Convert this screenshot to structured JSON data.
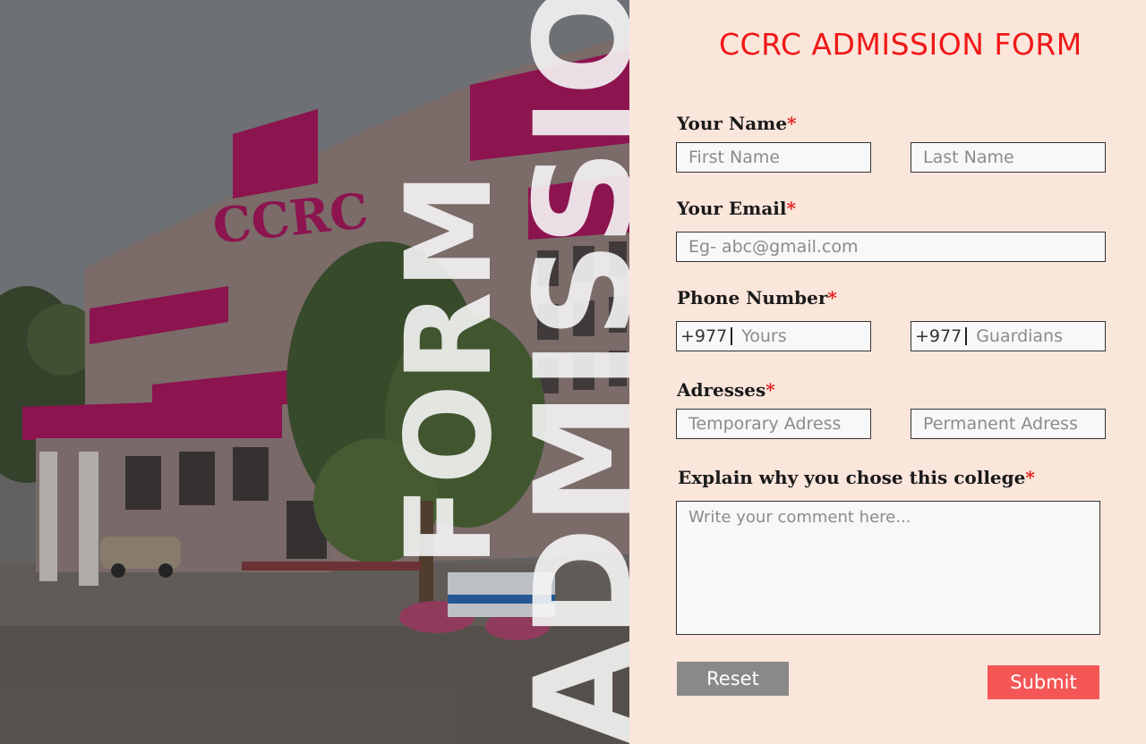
{
  "hero": {
    "building_sign": "CCRC",
    "overlay_word_1": "ADMISSION",
    "overlay_word_2": "FORM"
  },
  "form": {
    "title": "CCRC ADMISSION FORM",
    "required_marker": "*",
    "name": {
      "label": "Your Name",
      "first_placeholder": "First Name",
      "last_placeholder": "Last Name"
    },
    "email": {
      "label": "Your Email",
      "placeholder": "Eg- abc@gmail.com"
    },
    "phone": {
      "label": "Phone Number",
      "country_code": "+977",
      "yours_placeholder": "Yours",
      "guardians_placeholder": "Guardians"
    },
    "address": {
      "label": "Adresses",
      "temporary_placeholder": "Temporary Adress",
      "permanent_placeholder": "Permanent Adress"
    },
    "reason": {
      "label": "Explain why you chose this college",
      "placeholder": "Write your comment here..."
    },
    "reset_label": "Reset",
    "submit_label": "Submit"
  },
  "colors": {
    "title": "#f01818",
    "required": "#e31b1b",
    "panel_bg": "#fbe6dc",
    "reset_bg": "#898989",
    "submit_bg": "#f45656",
    "building_accent": "#a0175a"
  }
}
